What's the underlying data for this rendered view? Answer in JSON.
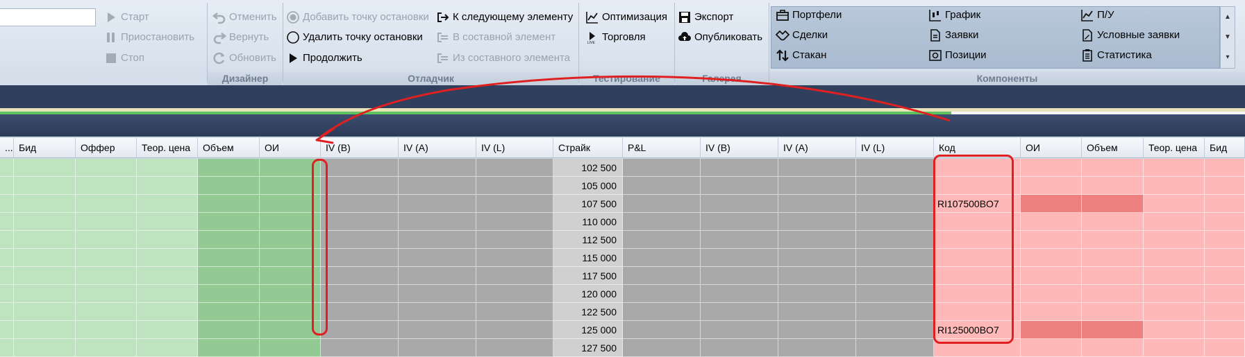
{
  "ribbon": {
    "run": {
      "start": "Старт",
      "pause": "Приостановить",
      "stop": "Стоп"
    },
    "designer": {
      "label": "Дизайнер",
      "undo": "Отменить",
      "redo": "Вернуть",
      "refresh": "Обновить"
    },
    "debugger": {
      "label": "Отладчик",
      "add_breakpoint": "Добавить точку остановки",
      "remove_breakpoint": "Удалить точку остановки",
      "continue": "Продолжить",
      "next_element": "К следующему элементу",
      "into_composite": "В составной элемент",
      "out_composite": "Из составного элемента"
    },
    "testing": {
      "label": "Тестирование",
      "optimization": "Оптимизация",
      "trading": "Торговля"
    },
    "gallery": {
      "label": "Галерея",
      "export": "Экспорт",
      "publish": "Опубликовать"
    },
    "components": {
      "label": "Компоненты",
      "items": [
        "Портфели",
        "График",
        "П/У",
        "Сделки",
        "Заявки",
        "Условные заявки",
        "Стакан",
        "Позиции",
        "Статистика"
      ]
    }
  },
  "grid": {
    "headers": [
      "...ь.",
      "Бид",
      "Оффер",
      "Теор. цена",
      "Объем",
      "ОИ",
      "IV (B)",
      "IV (A)",
      "IV (L)",
      "Страйк",
      "P&L",
      "IV (B)",
      "IV (A)",
      "IV (L)",
      "Код",
      "ОИ",
      "Объем",
      "Теор. цена",
      "Бид"
    ],
    "strikes": [
      "102 500",
      "105 000",
      "107 500",
      "110 000",
      "112 500",
      "115 000",
      "117 500",
      "120 000",
      "122 500",
      "125 000",
      "127 500"
    ],
    "codes": [
      "",
      "",
      "RI107500BO7",
      "",
      "",
      "",
      "",
      "",
      "",
      "RI125000BO7",
      ""
    ]
  }
}
